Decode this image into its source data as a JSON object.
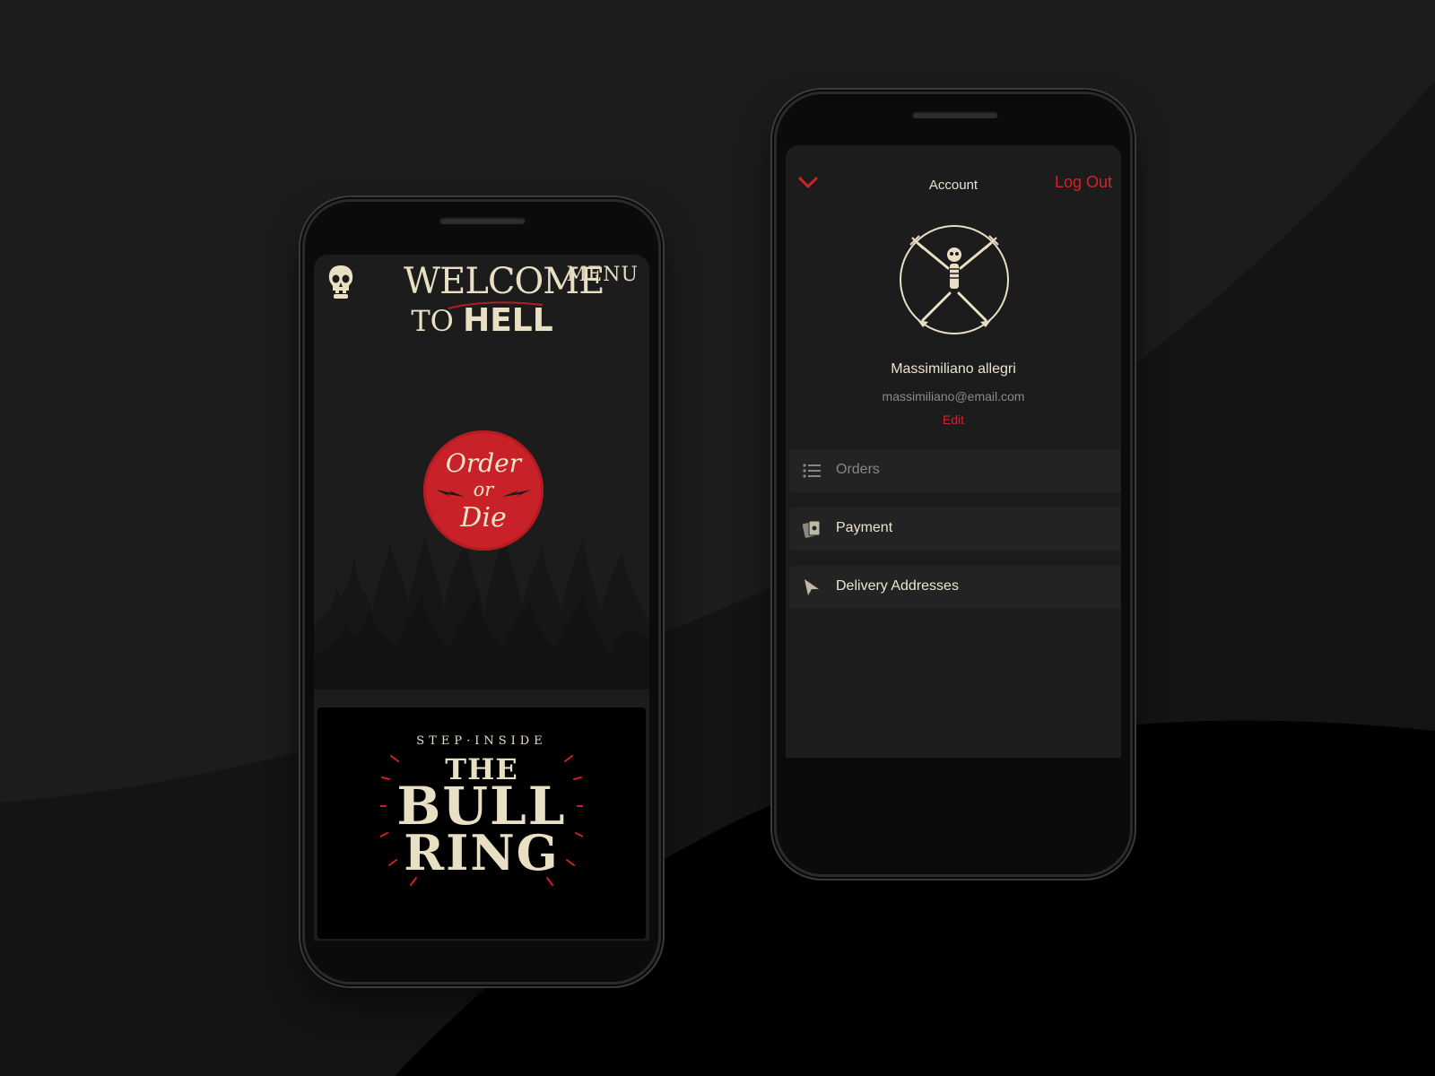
{
  "home_screen": {
    "menu_label": "MENU",
    "welcome_line1": "WELCOME",
    "welcome_line2_a": "TO",
    "welcome_line2_b": "HELL",
    "order_badge": {
      "line1": "Order",
      "line2": "or",
      "line3": "Die"
    },
    "bull_ring": {
      "line1": "STEP·INSIDE",
      "line2": "THE",
      "line3": "BULL",
      "line4": "RING"
    }
  },
  "account_screen": {
    "title": "Account",
    "logout_label": "Log Out",
    "user_name": "Massimiliano allegri",
    "user_email": "massimiliano@email.com",
    "edit_label": "Edit",
    "menu_items": [
      {
        "label": "Orders",
        "icon": "list-icon"
      },
      {
        "label": "Payment",
        "icon": "cards-icon"
      },
      {
        "label": "Delivery Addresses",
        "icon": "location-arrow-icon"
      }
    ]
  },
  "colors": {
    "accent_red": "#d6212a",
    "cream": "#e9dfc4",
    "screen_bg": "#1c1c1c",
    "row_bg": "#232323"
  }
}
